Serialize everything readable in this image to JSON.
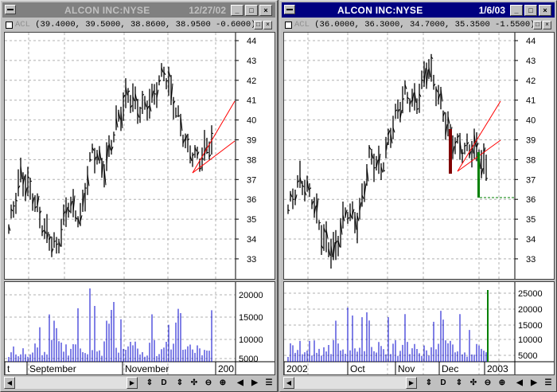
{
  "windows": [
    {
      "id": "left",
      "title": "ALCON INC:NYSE",
      "date": "12/27/02",
      "active": false,
      "quote_symbol": "ACL",
      "quote_values": "(39.4000, 39.5000, 38.8600, 38.9500 -0.6000)",
      "price_axis": [
        "44",
        "43",
        "42",
        "41",
        "40",
        "39",
        "38",
        "37",
        "36",
        "35",
        "34",
        "33"
      ],
      "volume_axis": [
        "20000",
        "15000",
        "10000",
        "5000"
      ],
      "time_labels": [
        "t",
        "September",
        "November",
        "200"
      ]
    },
    {
      "id": "right",
      "title": "ALCON INC:NYSE",
      "date": "1/6/03",
      "active": true,
      "quote_symbol": "ACL",
      "quote_values": "(36.0000, 36.3000, 34.7000, 35.3500 -1.5500)",
      "price_axis": [
        "44",
        "43",
        "42",
        "41",
        "40",
        "39",
        "38",
        "37",
        "36",
        "35",
        "34",
        "33"
      ],
      "volume_axis": [
        "25000",
        "20000",
        "15000",
        "10000",
        "5000"
      ],
      "time_labels": [
        "2002",
        "Oct",
        "Nov",
        "Dec",
        "2003"
      ]
    }
  ],
  "colors": {
    "bars": "#000000",
    "volume": "#0000cc",
    "channel": "#ff0000",
    "down_marker": "#800000",
    "up_marker": "#008000",
    "active_title": "#000080",
    "inactive_title": "#808080"
  },
  "icons": {
    "minimize": "minimize-icon",
    "maximize": "maximize-icon",
    "close": "close-icon",
    "scroll_left": "arrow-left-icon",
    "scroll_right": "arrow-right-icon"
  },
  "toolbar": {
    "tool_d": "D"
  }
}
